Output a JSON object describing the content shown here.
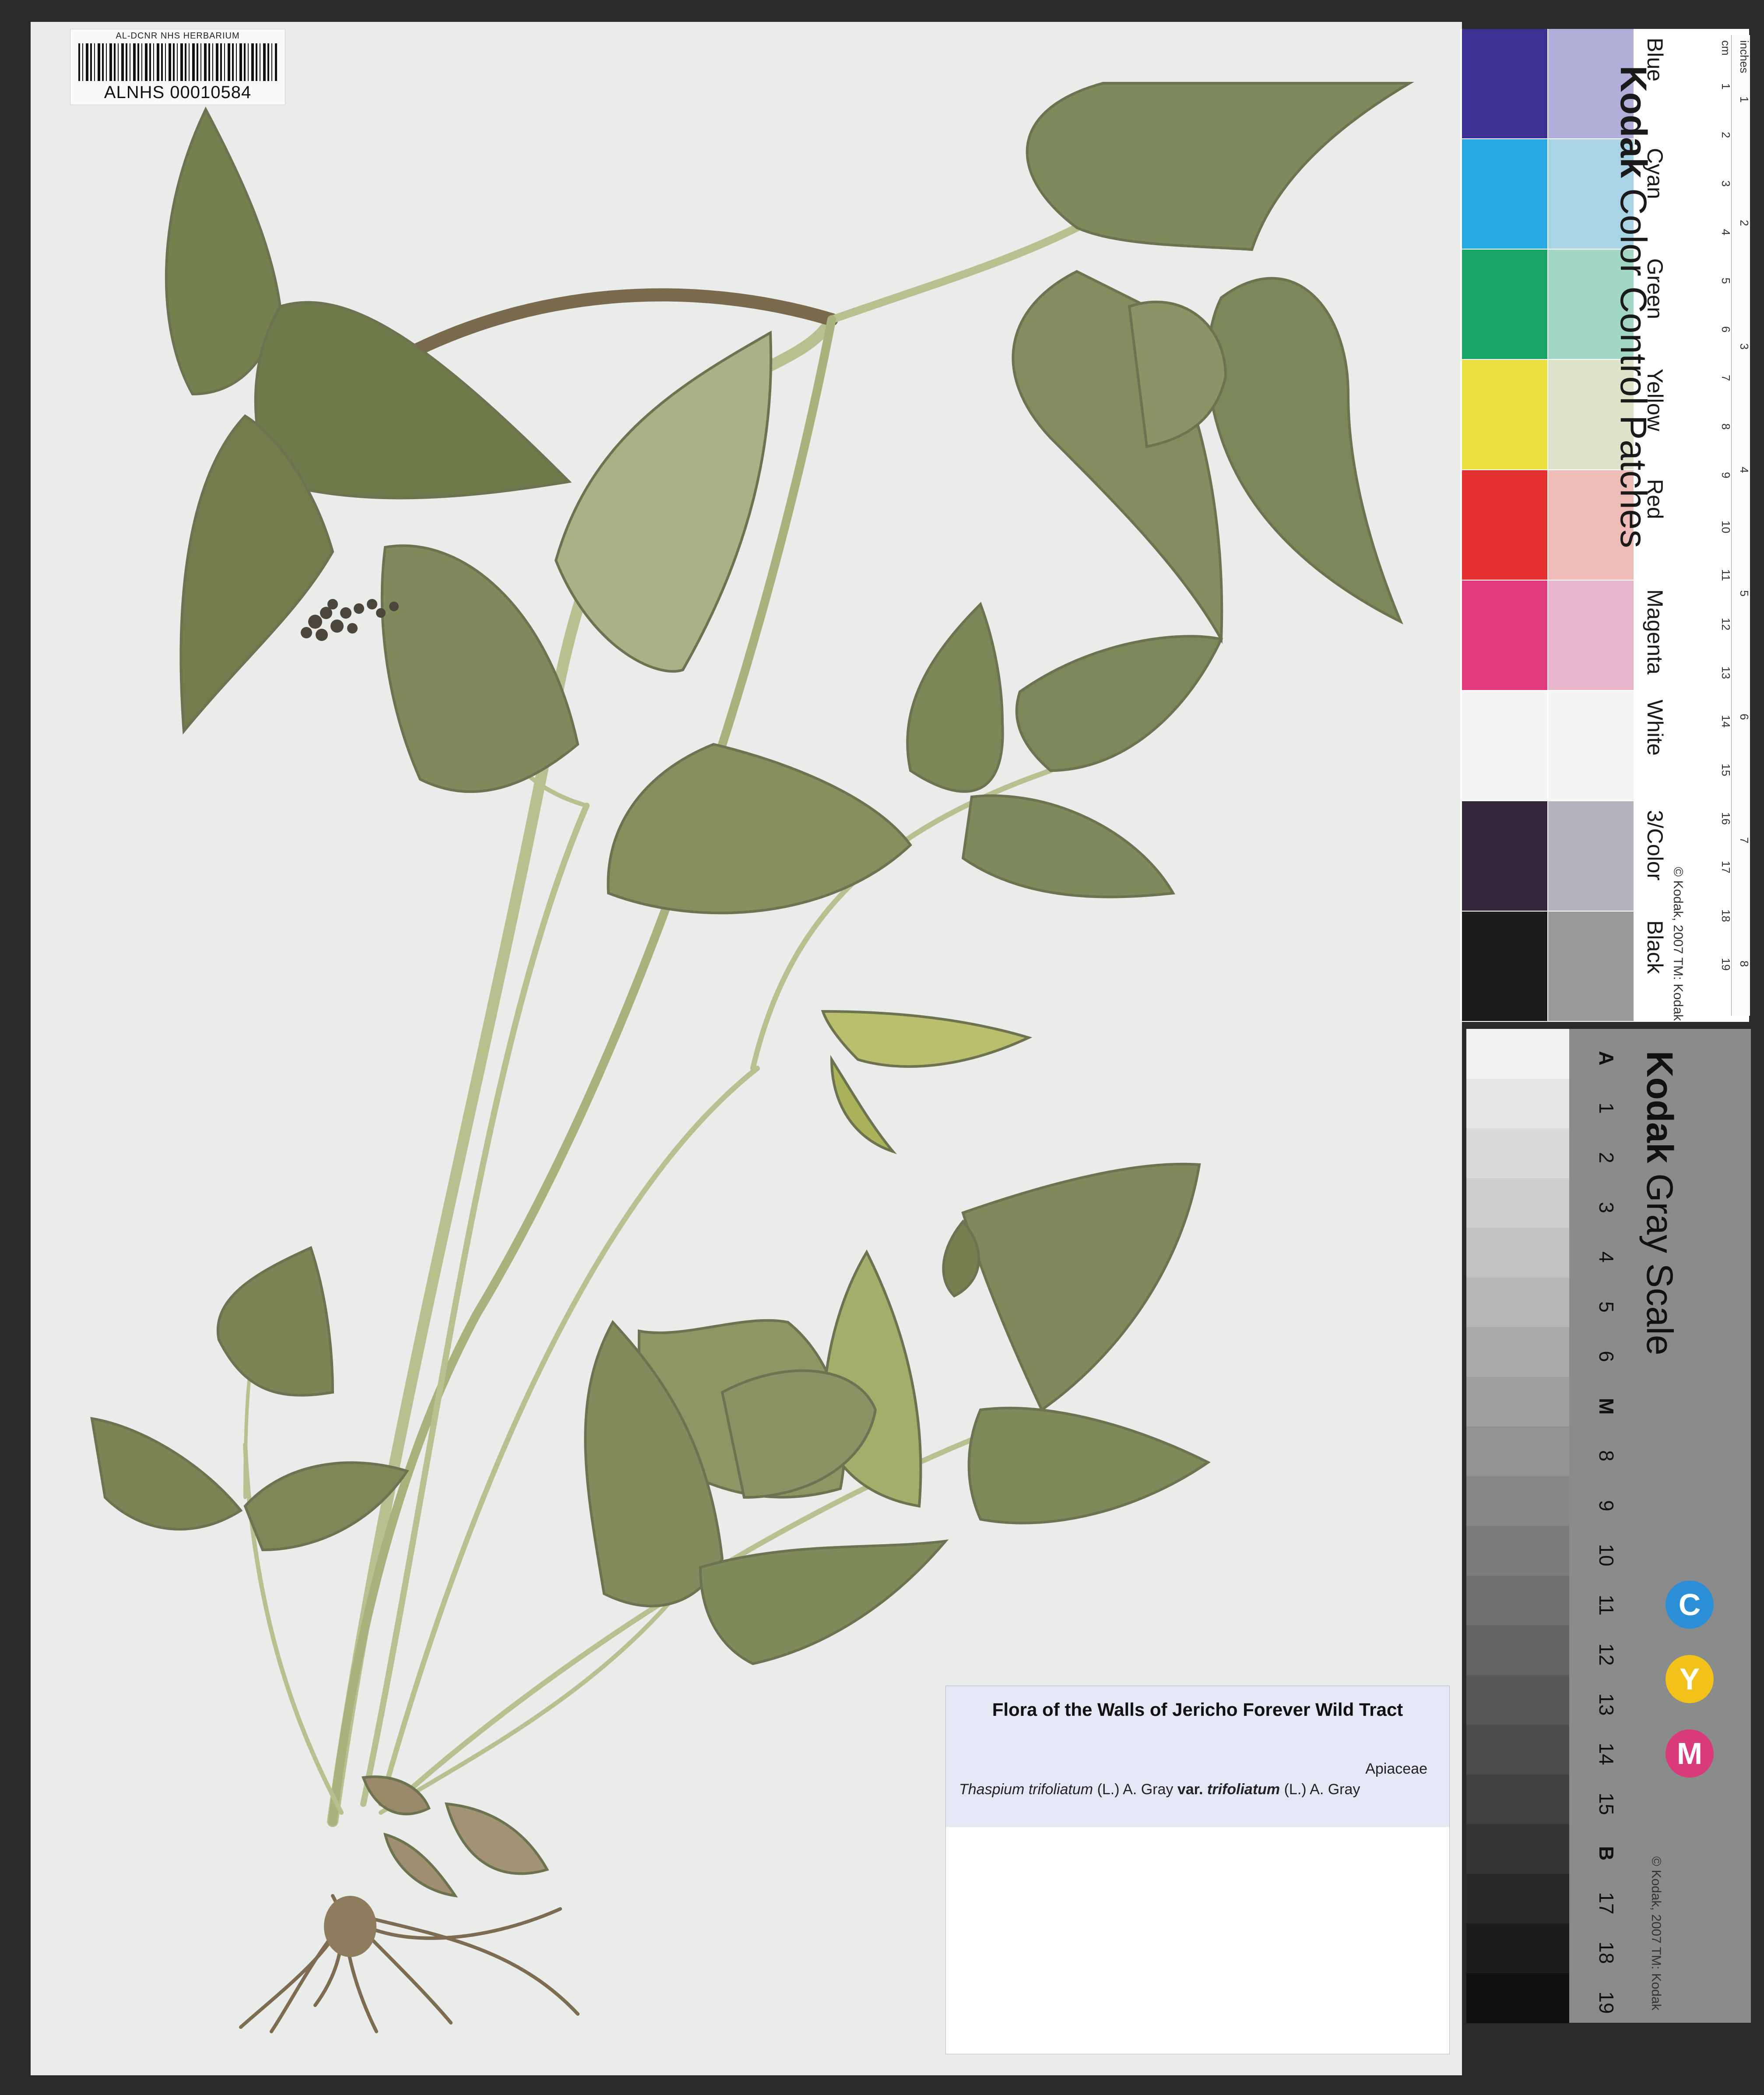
{
  "barcode": {
    "header": "AL-DCNR NHS HERBARIUM",
    "number": "ALNHS 00010584"
  },
  "label": {
    "title": "Flora of  the Walls of Jericho Forever Wild Tract",
    "family": "Apiaceae",
    "genus": "Thaspium",
    "species": "trifoliatum",
    "author": "(L.) A. Gray",
    "rank": "var.",
    "variety": "trifoliatum",
    "variety_author": "(L.) A. Gray"
  },
  "color_card": {
    "brand": "Kodak",
    "title": "Color Control Patches",
    "patches": [
      {
        "name": "Blue",
        "color": "#3a3192",
        "light": "#b1afda"
      },
      {
        "name": "Cyan",
        "color": "#27aae1",
        "light": "#a9d4e6"
      },
      {
        "name": "Green",
        "color": "#1aa567",
        "light": "#a2d6c6"
      },
      {
        "name": "Yellow",
        "color": "#ebe03d",
        "light": "#dde3c9"
      },
      {
        "name": "Red",
        "color": "#e5312f",
        "light": "#efbdb7"
      },
      {
        "name": "Magenta",
        "color": "#e13a7c",
        "light": "#e8b6cb"
      },
      {
        "name": "White",
        "color": "#f5f5f5",
        "light": "#f5f5f5"
      },
      {
        "name": "3/Color",
        "color": "#34283a",
        "light": "#b5b3bf"
      },
      {
        "name": "Black",
        "color": "#1c1c1c",
        "light": "#9a9a9a"
      }
    ],
    "ruler_units_cm": "cm",
    "ruler_units_in": "inches",
    "ruler_cm": [
      "1",
      "2",
      "3",
      "4",
      "5",
      "6",
      "7",
      "8",
      "9",
      "10",
      "11",
      "12",
      "13",
      "14",
      "15",
      "16",
      "17",
      "18",
      "19"
    ],
    "ruler_in": [
      "1",
      "2",
      "3",
      "4",
      "5",
      "6",
      "7",
      "8"
    ],
    "copyright": "© Kodak, 2007  TM: Kodak"
  },
  "gray_card": {
    "brand": "Kodak",
    "title": "Gray Scale",
    "steps": [
      "A",
      "1",
      "2",
      "3",
      "4",
      "5",
      "6",
      "M",
      "8",
      "9",
      "10",
      "11",
      "12",
      "13",
      "14",
      "15",
      "B",
      "17",
      "18",
      "19"
    ],
    "cmy": [
      "C",
      "Y",
      "M"
    ],
    "copyright": "© Kodak, 2007  TM: Kodak"
  }
}
